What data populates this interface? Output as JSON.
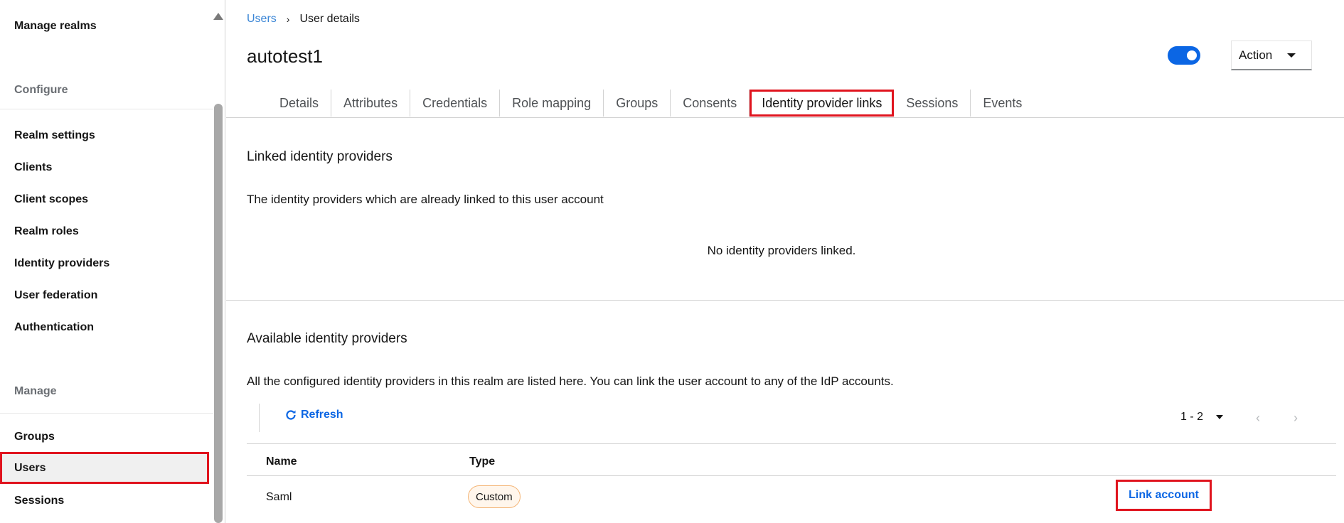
{
  "sidebar": {
    "manage_realms": "Manage realms",
    "configure_heading": "Configure",
    "configure_items": [
      "Realm settings",
      "Clients",
      "Client scopes",
      "Realm roles",
      "Identity providers",
      "User federation",
      "Authentication"
    ],
    "manage_heading": "Manage",
    "manage_items": [
      "Groups",
      "Users",
      "Sessions"
    ],
    "active_item": "Users"
  },
  "breadcrumb": {
    "parent": "Users",
    "separator": "›",
    "current": "User details"
  },
  "page": {
    "title": "autotest1",
    "enabled": true
  },
  "action_menu": {
    "label": "Action"
  },
  "tabs": [
    "Details",
    "Attributes",
    "Credentials",
    "Role mapping",
    "Groups",
    "Consents",
    "Identity provider links",
    "Sessions",
    "Events"
  ],
  "active_tab": "Identity provider links",
  "linked": {
    "title": "Linked identity providers",
    "description": "The identity providers which are already linked to this user account",
    "empty_message": "No identity providers linked."
  },
  "available": {
    "title": "Available identity providers",
    "description": "All the configured identity providers in this realm are listed here. You can link the user account to any of the IdP accounts.",
    "refresh_label": "Refresh",
    "pagination": "1 - 2",
    "columns": [
      "Name",
      "Type"
    ],
    "rows": [
      {
        "name": "Saml",
        "type": "Custom",
        "action": "Link account"
      }
    ]
  },
  "colors": {
    "accent": "#0b66e4",
    "highlight": "#e0141e",
    "badge_border": "#f4b678"
  }
}
